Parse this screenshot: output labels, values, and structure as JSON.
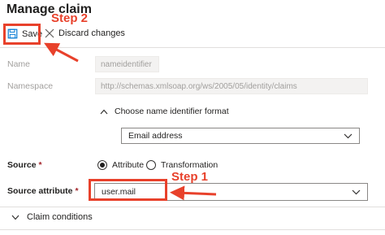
{
  "header": {
    "title": "Manage claim"
  },
  "toolbar": {
    "save_label": "Save",
    "discard_label": "Discard changes"
  },
  "form": {
    "name_label": "Name",
    "name_value": "nameidentifier",
    "namespace_label": "Namespace",
    "namespace_value": "http://schemas.xmlsoap.org/ws/2005/05/identity/claims",
    "name_id_section_label": "Choose name identifier format",
    "name_id_format_value": "Email address",
    "source_label": "Source",
    "source_options": [
      "Attribute",
      "Transformation"
    ],
    "source_selected": "Attribute",
    "source_attribute_label": "Source attribute",
    "source_attribute_value": "user.mail",
    "required_marker": "*",
    "claim_conditions_label": "Claim conditions"
  },
  "annotations": {
    "step1": "Step 1",
    "step2": "Step 2",
    "color": "#e8412b"
  },
  "icons": [
    "save-icon",
    "close-icon",
    "chevron-up-icon",
    "chevron-down-icon"
  ]
}
